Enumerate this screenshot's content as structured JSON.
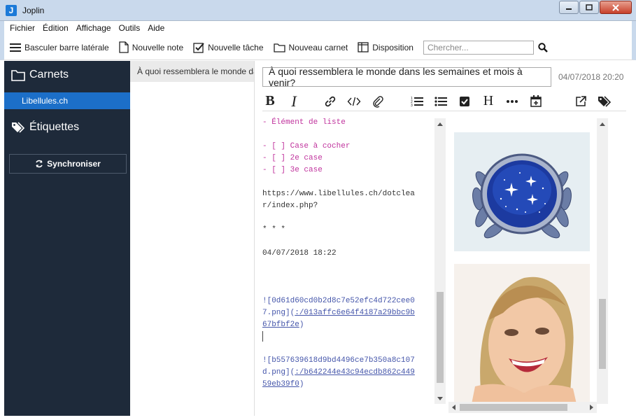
{
  "window": {
    "title": "Joplin",
    "app_icon_letter": "J"
  },
  "menu": [
    "Fichier",
    "Édition",
    "Affichage",
    "Outils",
    "Aide"
  ],
  "toolbar": {
    "toggle_sidebar": "Basculer barre latérale",
    "new_note": "Nouvelle note",
    "new_todo": "Nouvelle tâche",
    "new_notebook": "Nouveau carnet",
    "layout": "Disposition",
    "search_placeholder": "Chercher..."
  },
  "sidebar": {
    "notebooks_heading": "Carnets",
    "notebooks": [
      "Libellules.ch"
    ],
    "tags_heading": "Étiquettes",
    "sync_label": "Synchroniser"
  },
  "note_list": {
    "items": [
      "À quoi ressemblera le monde dans les semaines et mois à venir?"
    ]
  },
  "note": {
    "title": "À quoi ressemblera le monde dans les semaines et mois à venir?",
    "date": "04/07/2018 20:20"
  },
  "markdown": {
    "list_item": "- Élément de liste",
    "checkbox1": "- [ ] Case à cocher",
    "checkbox2": "- [ ] 2e case",
    "checkbox3": "- [ ] 3e case",
    "url_line1": "https://www.libellules.ch/dotclea",
    "url_line2": "r/index.php?",
    "hr": "* * *",
    "timestamp": "04/07/2018 18:22",
    "img1_line1": "![0d61d60cd0b2d8c7e52efc4d722cee0",
    "img1_line2a": "7.png](",
    "img1_line2b": ":/013affc6e64f4187a29bbc9b",
    "img1_line3a": "67bfbf2e",
    "img1_line3b": ")",
    "img2_line1": "![b557639618d9bd4496ce7b350a8c107",
    "img2_line2a": "d.png](",
    "img2_line2b": ":/b642244e43c94ecdb862c449",
    "img2_line3a": "59eb39f0",
    "img2_line3b": ")"
  },
  "colors": {
    "sidebar_bg": "#1e2a3a",
    "selected_notebook": "#1c6fc8",
    "markdown_list": "#c0339d",
    "markdown_link": "#4455aa"
  }
}
